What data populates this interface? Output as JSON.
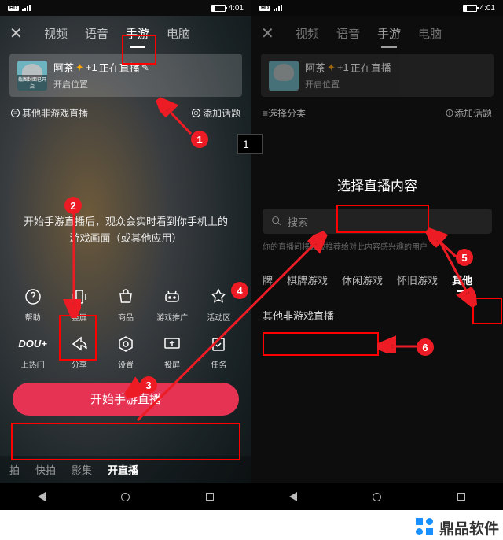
{
  "status": {
    "time": "4:01",
    "hd": "HD"
  },
  "close": "✕",
  "tabs": {
    "video": "视频",
    "voice": "语音",
    "game": "手游",
    "pc": "电脑"
  },
  "avatar_badge": "截图封面已开启",
  "card": {
    "user": "阿茶",
    "level": "+1",
    "status": "正在直播",
    "edit": "✎",
    "sub": "开启位置"
  },
  "row2_left": {
    "cat": "其他非游戏直播",
    "select": "选择分类"
  },
  "row2_right": "添加话题",
  "mid_text": "开始手游直播后，观众会实时看到你手机上的游戏画面（或其他应用）",
  "icons_r1": {
    "help": "帮助",
    "portrait": "竖屏",
    "shop": "商品",
    "recommend": "游戏推广",
    "activity": "活动区"
  },
  "icons_r2": {
    "dou": "DOU+",
    "dou_lbl": "上热门",
    "share": "分享",
    "settings": "设置",
    "cast": "投屏",
    "task": "任务"
  },
  "start_btn": "开始手游直播",
  "bottom": {
    "pai": "拍",
    "kuai": "快拍",
    "movie": "影集",
    "live": "开直播"
  },
  "right_panel": {
    "title": "选择直播内容",
    "search": "搜索",
    "hint": "你的直播间将会被推荐给对此内容感兴趣的用户",
    "cats": {
      "c1": "牌",
      "chess": "棋牌游戏",
      "casual": "休闲游戏",
      "retro": "怀旧游戏",
      "other": "其他"
    },
    "item": "其他非游戏直播"
  },
  "step": "1",
  "watermark": "鼎品软件"
}
